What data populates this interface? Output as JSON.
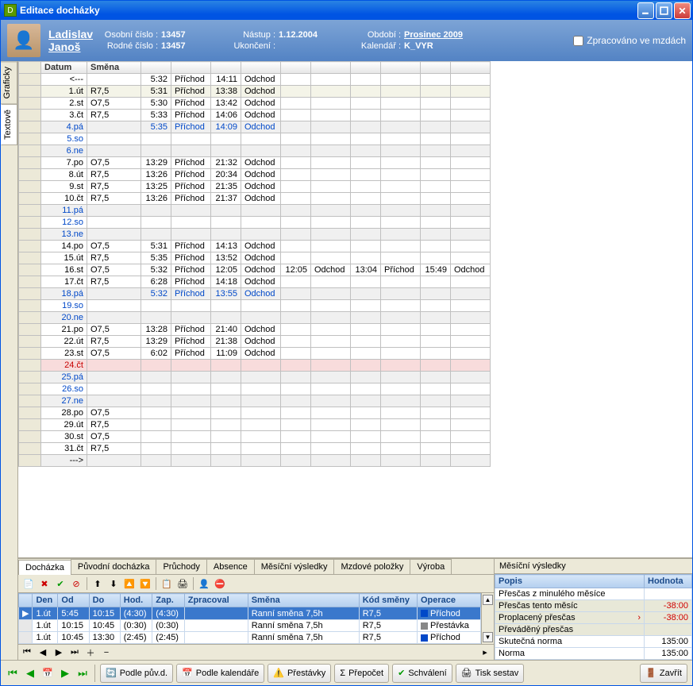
{
  "window": {
    "title": "Editace docházky",
    "icon": "D"
  },
  "header": {
    "firstname": "Ladislav",
    "lastname": "Janoš",
    "osobni_label": "Osobní číslo :",
    "osobni": "13457",
    "rodne_label": "Rodné číslo :",
    "rodne": "13457",
    "nastup_label": "Nástup :",
    "nastup": "1.12.2004",
    "ukonceni_label": "Ukončení :",
    "ukonceni": "",
    "obdobi_label": "Období :",
    "obdobi": "Prosinec 2009",
    "kalendar_label": "Kalendář :",
    "kalendar": "K_VYR",
    "checkbox_label": "Zpracováno ve mzdách"
  },
  "sidetabs": {
    "tab1": "Graficky",
    "tab2": "Textově"
  },
  "grid": {
    "headers": {
      "datum": "Datum",
      "smena": "Směna"
    },
    "rows": [
      {
        "d": "<---",
        "s": "",
        "t1": "5:32",
        "e1": "Příchod",
        "t2": "14:11",
        "e2": "Odchod",
        "cls": ""
      },
      {
        "d": "1.út",
        "s": "R7,5",
        "t1": "5:31",
        "e1": "Příchod",
        "t2": "13:38",
        "e2": "Odchod",
        "cls": "sel"
      },
      {
        "d": "2.st",
        "s": "O7,5",
        "t1": "5:30",
        "e1": "Příchod",
        "t2": "13:42",
        "e2": "Odchod",
        "cls": ""
      },
      {
        "d": "3.čt",
        "s": "R7,5",
        "t1": "5:33",
        "e1": "Příchod",
        "t2": "14:06",
        "e2": "Odchod",
        "cls": ""
      },
      {
        "d": "4.pá",
        "s": "",
        "t1": "5:35",
        "e1": "Příchod",
        "t2": "14:09",
        "e2": "Odchod",
        "cls": "blue alt"
      },
      {
        "d": "5.so",
        "s": "",
        "t1": "",
        "e1": "",
        "t2": "",
        "e2": "",
        "cls": "blue"
      },
      {
        "d": "6.ne",
        "s": "",
        "t1": "",
        "e1": "",
        "t2": "",
        "e2": "",
        "cls": "blue alt"
      },
      {
        "d": "7.po",
        "s": "O7,5",
        "t1": "13:29",
        "e1": "Příchod",
        "t2": "21:32",
        "e2": "Odchod",
        "cls": ""
      },
      {
        "d": "8.út",
        "s": "R7,5",
        "t1": "13:26",
        "e1": "Příchod",
        "t2": "20:34",
        "e2": "Odchod",
        "cls": ""
      },
      {
        "d": "9.st",
        "s": "R7,5",
        "t1": "13:25",
        "e1": "Příchod",
        "t2": "21:35",
        "e2": "Odchod",
        "cls": ""
      },
      {
        "d": "10.čt",
        "s": "R7,5",
        "t1": "13:26",
        "e1": "Příchod",
        "t2": "21:37",
        "e2": "Odchod",
        "cls": ""
      },
      {
        "d": "11.pá",
        "s": "",
        "t1": "",
        "e1": "",
        "t2": "",
        "e2": "",
        "cls": "blue alt"
      },
      {
        "d": "12.so",
        "s": "",
        "t1": "",
        "e1": "",
        "t2": "",
        "e2": "",
        "cls": "blue"
      },
      {
        "d": "13.ne",
        "s": "",
        "t1": "",
        "e1": "",
        "t2": "",
        "e2": "",
        "cls": "blue alt"
      },
      {
        "d": "14.po",
        "s": "O7,5",
        "t1": "5:31",
        "e1": "Příchod",
        "t2": "14:13",
        "e2": "Odchod",
        "cls": ""
      },
      {
        "d": "15.út",
        "s": "R7,5",
        "t1": "5:35",
        "e1": "Příchod",
        "t2": "13:52",
        "e2": "Odchod",
        "cls": ""
      },
      {
        "d": "16.st",
        "s": "O7,5",
        "t1": "5:32",
        "e1": "Příchod",
        "t2": "12:05",
        "e2": "Odchod",
        "t3": "12:05",
        "e3": "Odchod",
        "t4": "13:04",
        "e4": "Příchod",
        "t5": "15:49",
        "e5": "Odchod",
        "cls": ""
      },
      {
        "d": "17.čt",
        "s": "R7,5",
        "t1": "6:28",
        "e1": "Příchod",
        "t2": "14:18",
        "e2": "Odchod",
        "cls": ""
      },
      {
        "d": "18.pá",
        "s": "",
        "t1": "5:32",
        "e1": "Příchod",
        "t2": "13:55",
        "e2": "Odchod",
        "cls": "blue alt"
      },
      {
        "d": "19.so",
        "s": "",
        "t1": "",
        "e1": "",
        "t2": "",
        "e2": "",
        "cls": "blue"
      },
      {
        "d": "20.ne",
        "s": "",
        "t1": "",
        "e1": "",
        "t2": "",
        "e2": "",
        "cls": "blue alt"
      },
      {
        "d": "21.po",
        "s": "O7,5",
        "t1": "13:28",
        "e1": "Příchod",
        "t2": "21:40",
        "e2": "Odchod",
        "cls": ""
      },
      {
        "d": "22.út",
        "s": "R7,5",
        "t1": "13:29",
        "e1": "Příchod",
        "t2": "21:38",
        "e2": "Odchod",
        "cls": ""
      },
      {
        "d": "23.st",
        "s": "O7,5",
        "t1": "6:02",
        "e1": "Příchod",
        "t2": "11:09",
        "e2": "Odchod",
        "cls": ""
      },
      {
        "d": "24.čt",
        "s": "",
        "t1": "",
        "e1": "",
        "t2": "",
        "e2": "",
        "cls": "red"
      },
      {
        "d": "25.pá",
        "s": "",
        "t1": "",
        "e1": "",
        "t2": "",
        "e2": "",
        "cls": "blue alt"
      },
      {
        "d": "26.so",
        "s": "",
        "t1": "",
        "e1": "",
        "t2": "",
        "e2": "",
        "cls": "blue"
      },
      {
        "d": "27.ne",
        "s": "",
        "t1": "",
        "e1": "",
        "t2": "",
        "e2": "",
        "cls": "blue alt"
      },
      {
        "d": "28.po",
        "s": "O7,5",
        "t1": "",
        "e1": "",
        "t2": "",
        "e2": "",
        "cls": ""
      },
      {
        "d": "29.út",
        "s": "R7,5",
        "t1": "",
        "e1": "",
        "t2": "",
        "e2": "",
        "cls": ""
      },
      {
        "d": "30.st",
        "s": "O7,5",
        "t1": "",
        "e1": "",
        "t2": "",
        "e2": "",
        "cls": ""
      },
      {
        "d": "31.čt",
        "s": "R7,5",
        "t1": "",
        "e1": "",
        "t2": "",
        "e2": "",
        "cls": ""
      },
      {
        "d": "--->",
        "s": "",
        "t1": "",
        "e1": "",
        "t2": "",
        "e2": "",
        "cls": "alt"
      }
    ]
  },
  "tabs": {
    "t0": "Docházka",
    "t1": "Původní docházka",
    "t2": "Průchody",
    "t3": "Absence",
    "t4": "Měsíční výsledky",
    "t5": "Mzdové položky",
    "t6": "Výroba",
    "rtitle": "Měsíční výsledky"
  },
  "subgrid": {
    "headers": {
      "den": "Den",
      "od": "Od",
      "do": "Do",
      "hod": "Hod.",
      "zap": "Zap.",
      "zpracoval": "Zpracoval",
      "smena": "Směna",
      "kod": "Kód směny",
      "operace": "Operace"
    },
    "rows": [
      {
        "sel": true,
        "den": "1.út",
        "od": "5:45",
        "do": "10:15",
        "hod": "(4:30)",
        "zap": "(4:30)",
        "zpr": "",
        "sm": "Ranní směna 7,5h",
        "kod": "R7,5",
        "op": "Příchod",
        "opcolor": "#0048c8"
      },
      {
        "sel": false,
        "den": "1.út",
        "od": "10:15",
        "do": "10:45",
        "hod": "(0:30)",
        "zap": "(0:30)",
        "zpr": "",
        "sm": "Ranní směna 7,5h",
        "kod": "R7,5",
        "op": "Přestávka",
        "opcolor": "#888888"
      },
      {
        "sel": false,
        "den": "1.út",
        "od": "10:45",
        "do": "13:30",
        "hod": "(2:45)",
        "zap": "(2:45)",
        "zpr": "",
        "sm": "Ranní směna 7,5h",
        "kod": "R7,5",
        "op": "Příchod",
        "opcolor": "#0048c8"
      }
    ]
  },
  "results": {
    "hpopis": "Popis",
    "hhodnota": "Hodnota",
    "rows": [
      {
        "p": "Přesčas z minulého měsíce",
        "v": "",
        "hl": false,
        "neg": false
      },
      {
        "p": "Přesčas tento měsíc",
        "v": "-38:00",
        "hl": true,
        "neg": true
      },
      {
        "p": "Proplacený přesčas",
        "v": "-38:00",
        "hl": true,
        "neg": true,
        "mark": true
      },
      {
        "p": "Převáděný přesčas",
        "v": "",
        "hl": true,
        "neg": false
      },
      {
        "p": "Skutečná norma",
        "v": "135:00",
        "hl": false,
        "neg": false
      },
      {
        "p": "Norma",
        "v": "135:00",
        "hl": false,
        "neg": false
      }
    ]
  },
  "footer": {
    "b1": "Podle pův.d.",
    "b2": "Podle kalendáře",
    "b3": "Přestávky",
    "b4": "Přepočet",
    "b5": "Schválení",
    "b6": "Tisk sestav",
    "b7": "Zavřít"
  }
}
